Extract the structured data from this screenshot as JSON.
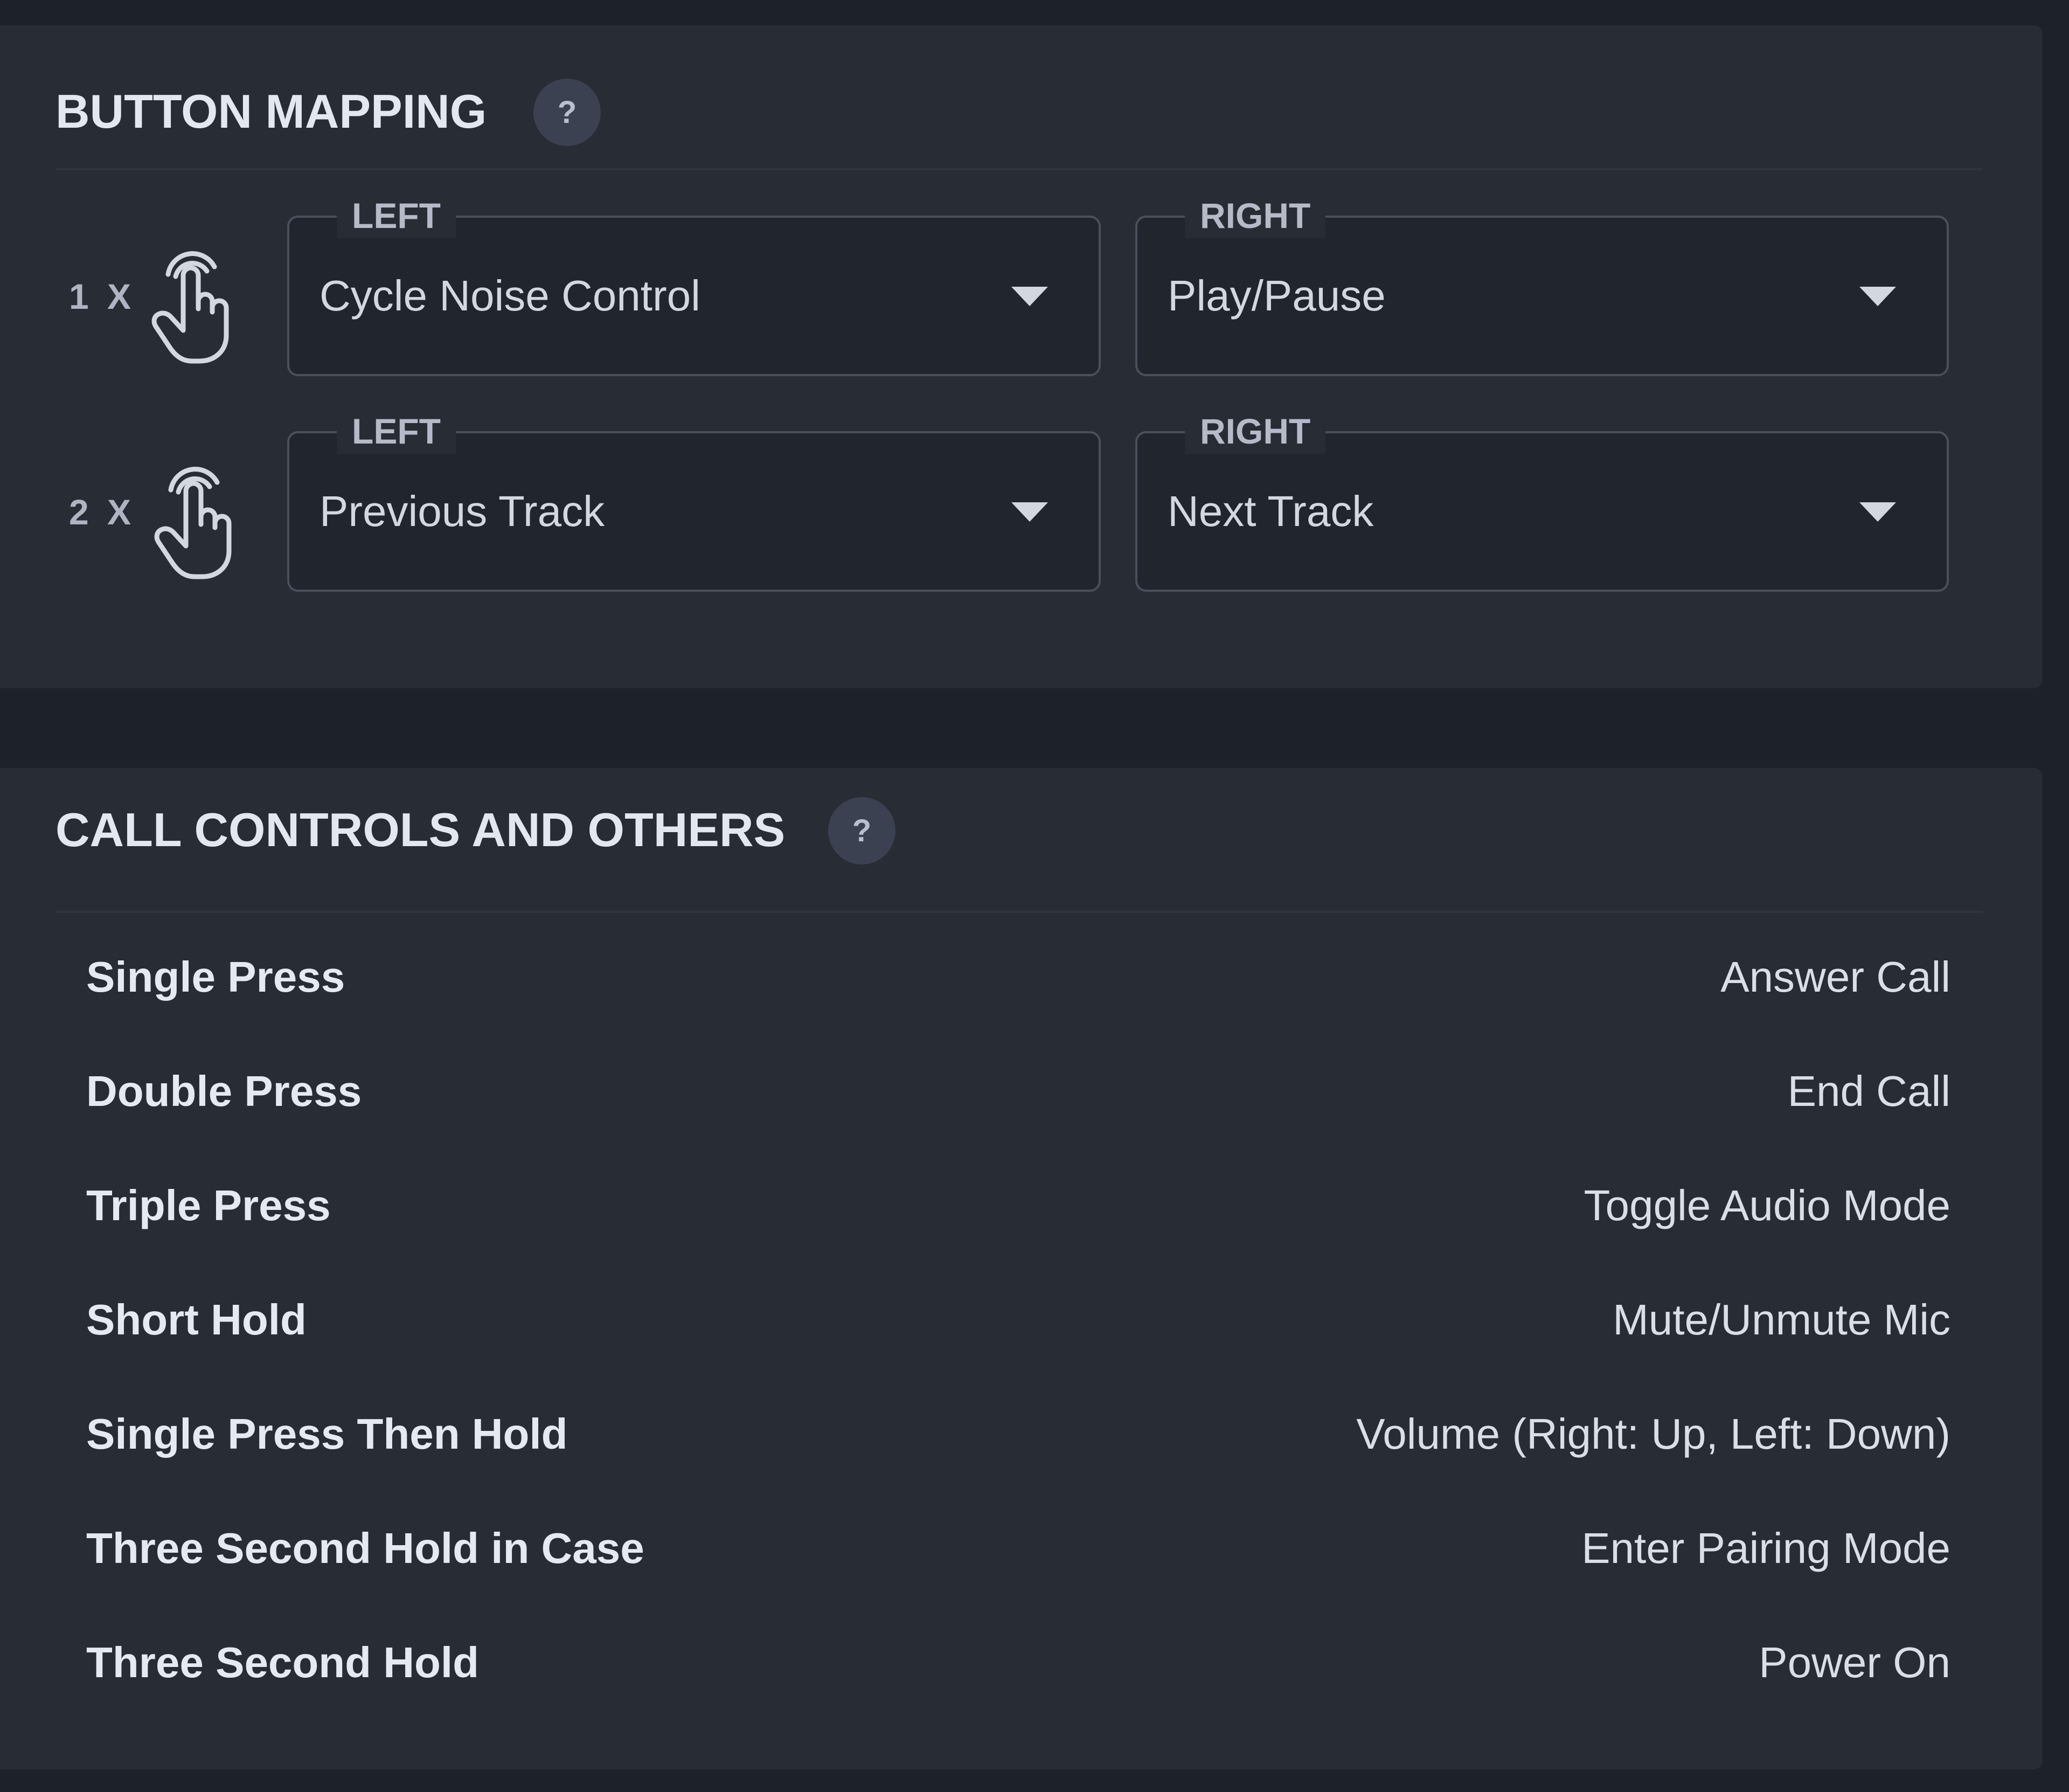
{
  "button_mapping": {
    "title": "BUTTON MAPPING",
    "help_label": "?",
    "rows": [
      {
        "label": "1 X",
        "icon": "tap-hand-icon",
        "left": {
          "legend": "LEFT",
          "value": "Cycle Noise Control"
        },
        "right": {
          "legend": "RIGHT",
          "value": "Play/Pause"
        }
      },
      {
        "label": "2 X",
        "icon": "tap-hand-icon",
        "left": {
          "legend": "LEFT",
          "value": "Previous Track"
        },
        "right": {
          "legend": "RIGHT",
          "value": "Next Track"
        }
      }
    ]
  },
  "call_controls": {
    "title": "CALL CONTROLS AND OTHERS",
    "help_label": "?",
    "rows": [
      {
        "action": "Single Press",
        "result": "Answer Call"
      },
      {
        "action": "Double Press",
        "result": "End Call"
      },
      {
        "action": "Triple Press",
        "result": "Toggle Audio Mode"
      },
      {
        "action": "Short Hold",
        "result": "Mute/Unmute Mic"
      },
      {
        "action": "Single Press Then Hold",
        "result": "Volume (Right: Up, Left: Down)"
      },
      {
        "action": "Three Second Hold in Case",
        "result": "Enter Pairing Mode"
      },
      {
        "action": "Three Second Hold",
        "result": "Power On"
      }
    ]
  },
  "colors": {
    "background": "#1d2129",
    "panel": "#272c35",
    "title_text": "#e4e7ef",
    "border": "#4a4f5c"
  }
}
